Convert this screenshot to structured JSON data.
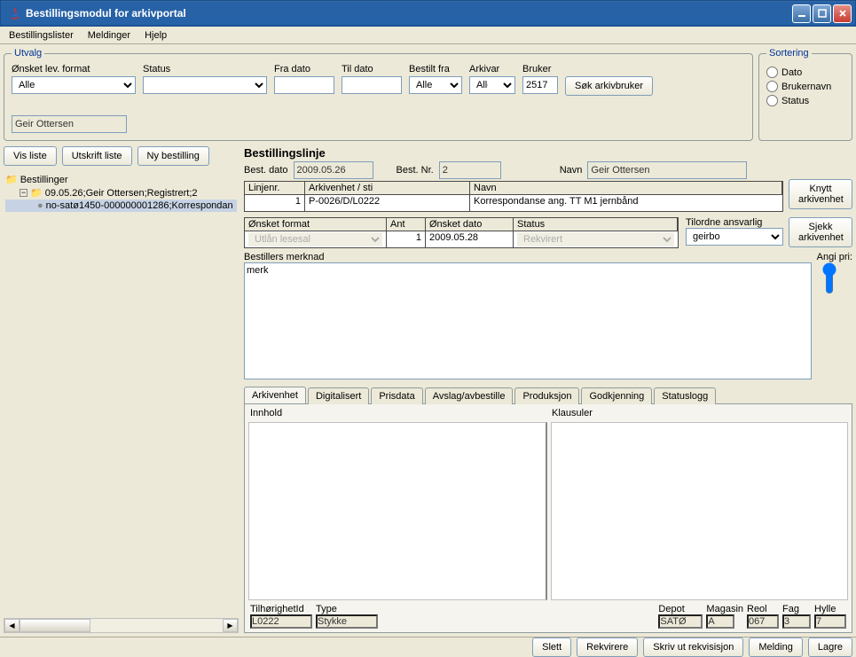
{
  "window": {
    "title": "Bestillingsmodul for arkivportal"
  },
  "menu": {
    "items": [
      "Bestillingslister",
      "Meldinger",
      "Hjelp"
    ]
  },
  "filters": {
    "legend": "Utvalg",
    "fields": {
      "format_lbl": "Ønsket lev. format",
      "format_val": "Alle",
      "status_lbl": "Status",
      "status_val": "",
      "fra_lbl": "Fra dato",
      "fra_val": "",
      "til_lbl": "Til dato",
      "til_val": "",
      "bestilt_lbl": "Bestilt fra",
      "bestilt_val": "Alle",
      "arkivar_lbl": "Arkivar",
      "arkivar_val": "Alle",
      "bruker_lbl": "Bruker",
      "bruker_val": "2517",
      "sok_btn": "Søk arkivbruker",
      "user_name": "Geir Ottersen"
    }
  },
  "sort": {
    "legend": "Sortering",
    "opts": {
      "dato": "Dato",
      "bruker": "Brukernavn",
      "status": "Status"
    }
  },
  "toolbar": {
    "vis": "Vis liste",
    "utskrift": "Utskrift liste",
    "ny": "Ny bestilling"
  },
  "tree": {
    "root": "Bestillinger",
    "n1": "09.05.26;Geir Ottersen;Registrert;2",
    "n2": "no-satø1450-000000001286;Korrespondan"
  },
  "line": {
    "title": "Bestillingslinje",
    "best_dato_lbl": "Best. dato",
    "best_dato": "2009.05.26",
    "best_nr_lbl": "Best. Nr.",
    "best_nr": "2",
    "navn_lbl": "Navn",
    "navn": "Geir Ottersen",
    "g1h": {
      "c1": "Linjenr.",
      "c2": "Arkivenhet / sti",
      "c3": "Navn"
    },
    "g1r": {
      "c1": "1",
      "c2": "P-0026/D/L0222",
      "c3": "Korrespondanse ang. TT M1 jernbånd"
    },
    "g2h": {
      "c1": "Ønsket format",
      "c2": "Ant",
      "c3": "Ønsket dato",
      "c4": "Status"
    },
    "g2r": {
      "c1": "Utlån lesesal",
      "c2": "1",
      "c3": "2009.05.28",
      "c4": "Rekvirert"
    },
    "tilordne_lbl": "Tilordne ansvarlig",
    "tilordne_val": "geirbo",
    "knytt_btn": "Knytt arkivenhet",
    "sjekk_btn": "Sjekk arkivenhet",
    "merknad_lbl": "Bestillers merknad",
    "merknad_val": "merk",
    "angi_lbl": "Angi pri:"
  },
  "tabs": {
    "t1": "Arkivenhet",
    "t2": "Digitalisert",
    "t3": "Prisdata",
    "t4": "Avslag/avbestille",
    "t5": "Produksjon",
    "t6": "Godkjenning",
    "t7": "Statuslogg",
    "innhold_lbl": "Innhold",
    "klausuler_lbl": "Klausuler"
  },
  "loc": {
    "tilh_lbl": "TilhørighetId",
    "tilh": "L0222",
    "type_lbl": "Type",
    "type": "Stykke",
    "depot_lbl": "Depot",
    "depot": "SATØ",
    "mag_lbl": "Magasin",
    "mag": "A",
    "reol_lbl": "Reol",
    "reol": "067",
    "fag_lbl": "Fag",
    "fag": "3",
    "hylle_lbl": "Hylle",
    "hylle": "7"
  },
  "footer": {
    "slett": "Slett",
    "rekvirere": "Rekvirere",
    "skriv": "Skriv ut rekvisisjon",
    "melding": "Melding",
    "lagre": "Lagre"
  }
}
